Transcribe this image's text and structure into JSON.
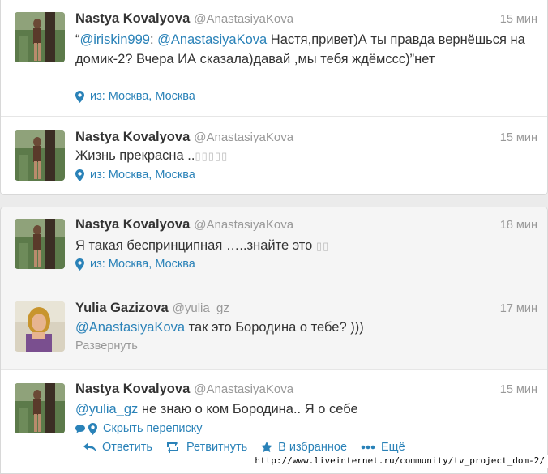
{
  "tweets_top": [
    {
      "name": "Nastya Kovalyova",
      "handle": "@AnastasiyaKova",
      "time": "15 мин",
      "text_open": "“",
      "mention1": "@iriskin999",
      "text_colon": ": ",
      "mention2": "@AnastasiyaKova",
      "text_rest": " Настя,привет)А ты правда вернёшься на домик-2? Вчера ИА сказала)давай ,мы тебя ждёмсcс)”нет",
      "location": "из: Москва, Москва"
    },
    {
      "name": "Nastya Kovalyova",
      "handle": "@AnastasiyaKova",
      "time": "15 мин",
      "text": "Жизнь прекрасна ..",
      "boxes": "▯▯▯▯▯",
      "location": "из: Москва, Москва"
    }
  ],
  "tweets_bottom": [
    {
      "name": "Nastya Kovalyova",
      "handle": "@AnastasiyaKova",
      "time": "18 мин",
      "text": "Я такая беспринципная …..знайте это ",
      "boxes": "▯▯",
      "location": "из: Москва, Москва"
    },
    {
      "name": "Yulia Gazizova",
      "handle": "@yulia_gz",
      "time": "17 мин",
      "mention": "@AnastasiyaKova",
      "text": " так это Бородина о тебе? )))",
      "expand": "Развернуть"
    },
    {
      "name": "Nastya Kovalyova",
      "handle": "@AnastasiyaKova",
      "time": "15 мин",
      "mention": "@yulia_gz",
      "text": " не знаю о ком Бородина.. Я о себе",
      "hide_thread": "Скрыть переписку"
    }
  ],
  "actions": {
    "reply": "Ответить",
    "retweet": "Ретвитнуть",
    "favorite": "В избранное",
    "more": "Ещё"
  },
  "footer_url": "http://www.liveinternet.ru/community/tv_project_dom-2/",
  "colors": {
    "link": "#2a82b8",
    "muted": "#999999",
    "highlight": "#f5f5f5"
  }
}
